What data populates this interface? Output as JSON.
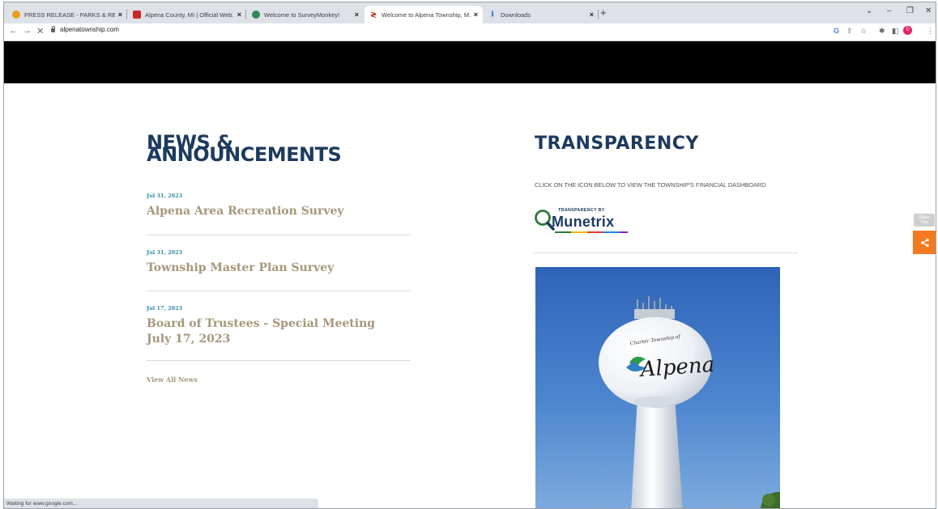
{
  "browser": {
    "tabs": [
      {
        "title": "PRESS RELEASE - PARKS & RECR...",
        "favicon_color": "#e8a020"
      },
      {
        "title": "Alpena County, MI | Official Web...",
        "favicon_color": "#c62828"
      },
      {
        "title": "Welcome to SurveyMonkey!",
        "favicon_color": "#2e8b57"
      },
      {
        "title": "Welcome to Alpena Township, M...",
        "favicon_color": "#c0392b",
        "active": true
      },
      {
        "title": "Downloads",
        "favicon_color": "#1a73e8"
      }
    ],
    "new_tab": "+",
    "url": "alpenatownship.com",
    "status_text": "Waiting for www.google.com..."
  },
  "news": {
    "heading": "NEWS & ANNOUNCEMENTS",
    "items": [
      {
        "date": "Jul 31, 2023",
        "title": "Alpena Area Recreation Survey"
      },
      {
        "date": "Jul 31, 2023",
        "title": "Township Master Plan Survey"
      },
      {
        "date": "Jul 17, 2023",
        "title": "Board of Trustees - Special Meeting July 17, 2023"
      }
    ],
    "view_all": "View All News"
  },
  "transparency": {
    "heading": "TRANSPARENCY",
    "instruction": "CLICK ON THE ICON BELOW TO VIEW THE TOWNSHIP'S FINANCIAL DASHBOARD",
    "logo_prefix": "TRANSPARENCY BY",
    "logo_name": "Munetrix"
  },
  "photo": {
    "tank_line1": "Charter Township of",
    "tank_line2": "Alpena"
  },
  "sidebar": {
    "label": "Share This",
    "share_color": "#f37a21"
  }
}
